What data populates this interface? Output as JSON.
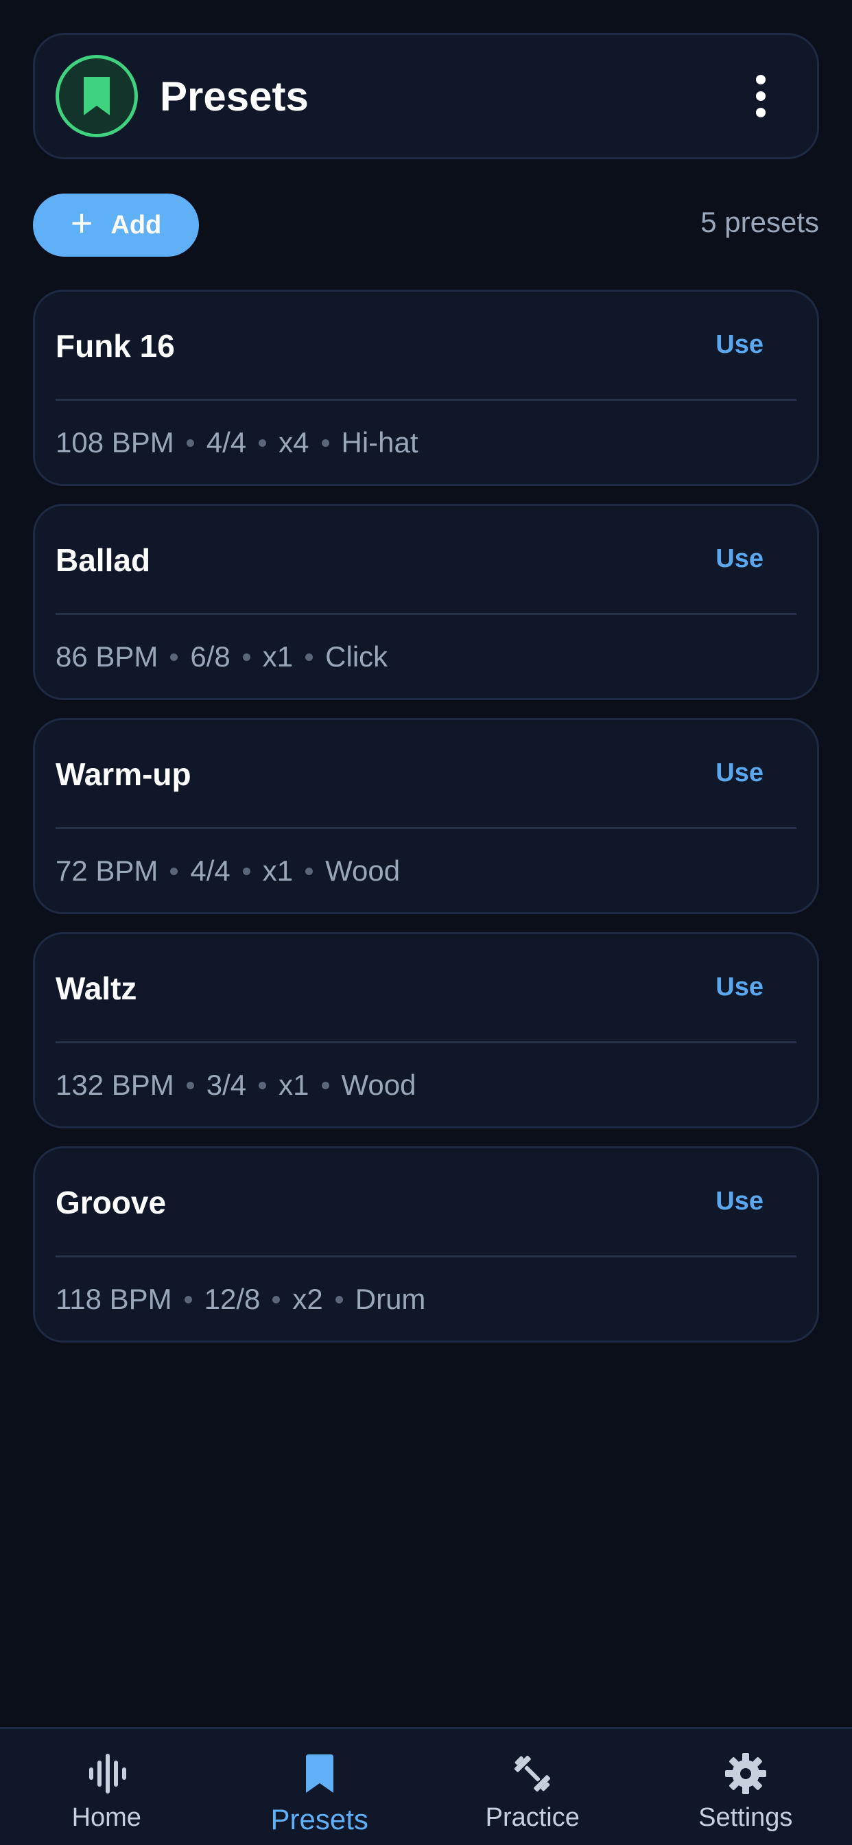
{
  "header": {
    "title": "Presets",
    "badge_icon": "bookmark-icon",
    "menu_icon": "more-vertical-icon"
  },
  "toolbar": {
    "add_label": "Add",
    "add_icon": "plus-icon",
    "count_text": "5 presets"
  },
  "presets": [
    {
      "name": "Funk 16",
      "action": "Use",
      "meta": [
        "108 BPM",
        "4/4",
        "x4",
        "Hi-hat"
      ]
    },
    {
      "name": "Ballad",
      "action": "Use",
      "meta": [
        "86 BPM",
        "6/8",
        "x1",
        "Click"
      ]
    },
    {
      "name": "Warm-up",
      "action": "Use",
      "meta": [
        "72 BPM",
        "4/4",
        "x1",
        "Wood"
      ]
    },
    {
      "name": "Waltz",
      "action": "Use",
      "meta": [
        "132 BPM",
        "3/4",
        "x1",
        "Wood"
      ]
    },
    {
      "name": "Groove",
      "action": "Use",
      "meta": [
        "118 BPM",
        "12/8",
        "x2",
        "Drum"
      ]
    }
  ],
  "nav": {
    "items": [
      {
        "label": "Home",
        "icon": "waveform-icon",
        "active": false
      },
      {
        "label": "Presets",
        "icon": "bookmark-icon",
        "active": true
      },
      {
        "label": "Practice",
        "icon": "dumbbell-icon",
        "active": false
      },
      {
        "label": "Settings",
        "icon": "gear-icon",
        "active": false
      }
    ]
  },
  "colors": {
    "background": "#0a0f1a",
    "card": "#0f1729",
    "accent": "#60b0f8",
    "badge_green": "#3fd27f",
    "muted_text": "#9aa7bb"
  }
}
